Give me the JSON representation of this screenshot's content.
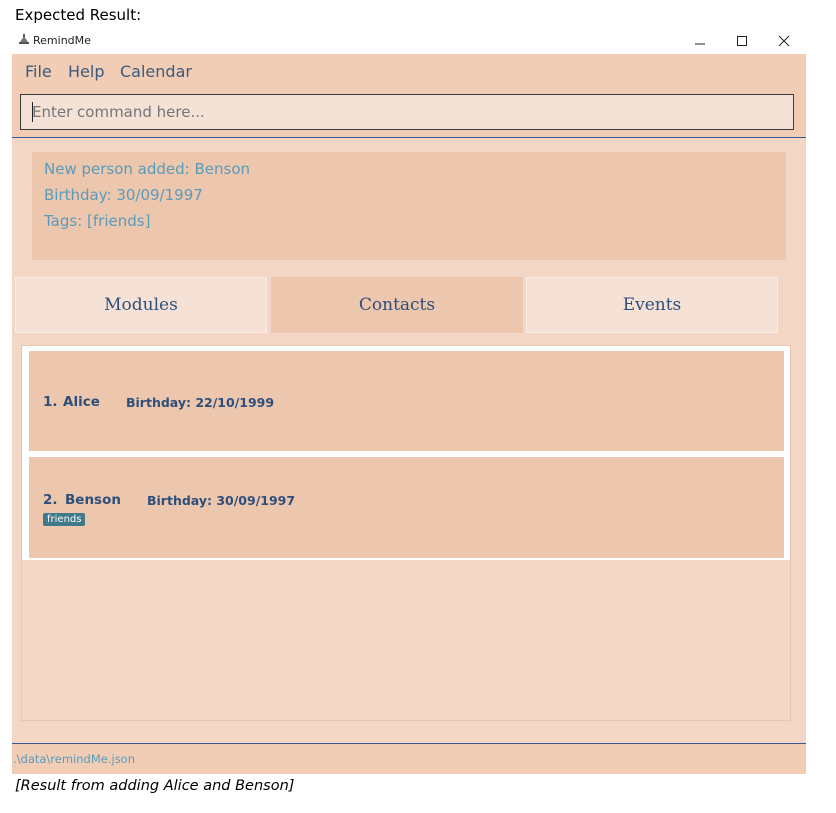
{
  "caption_top": "Expected Result:",
  "caption_bottom": "[Result from adding Alice and Benson]",
  "window": {
    "title": "RemindMe",
    "controls": {
      "minimize_icon": "minimize-icon",
      "maximize_icon": "maximize-icon",
      "close_icon": "close-icon"
    }
  },
  "menu": {
    "items": [
      "File",
      "Help",
      "Calendar"
    ]
  },
  "command": {
    "placeholder": "Enter command here...",
    "value": ""
  },
  "result": {
    "lines": [
      "New person added: Benson",
      "Birthday: 30/09/1997",
      "Tags: [friends]"
    ]
  },
  "tabs": [
    {
      "label": "Modules",
      "active": false
    },
    {
      "label": "Contacts",
      "active": true
    },
    {
      "label": "Events",
      "active": false
    }
  ],
  "contacts": [
    {
      "index": "1.",
      "name": "Alice",
      "birthday": "Birthday: 22/10/1999",
      "tags": []
    },
    {
      "index": "2.",
      "name": "Benson",
      "birthday": "Birthday: 30/09/1997",
      "tags": [
        "friends"
      ]
    }
  ],
  "status": {
    "path": ".\\data\\remindMe.json"
  },
  "colors": {
    "background": "#f3d6c5",
    "card": "#ecc6ad",
    "text": "#2f4f7a",
    "result_text": "#5a9bbb",
    "tag": "#3f7a8a"
  }
}
